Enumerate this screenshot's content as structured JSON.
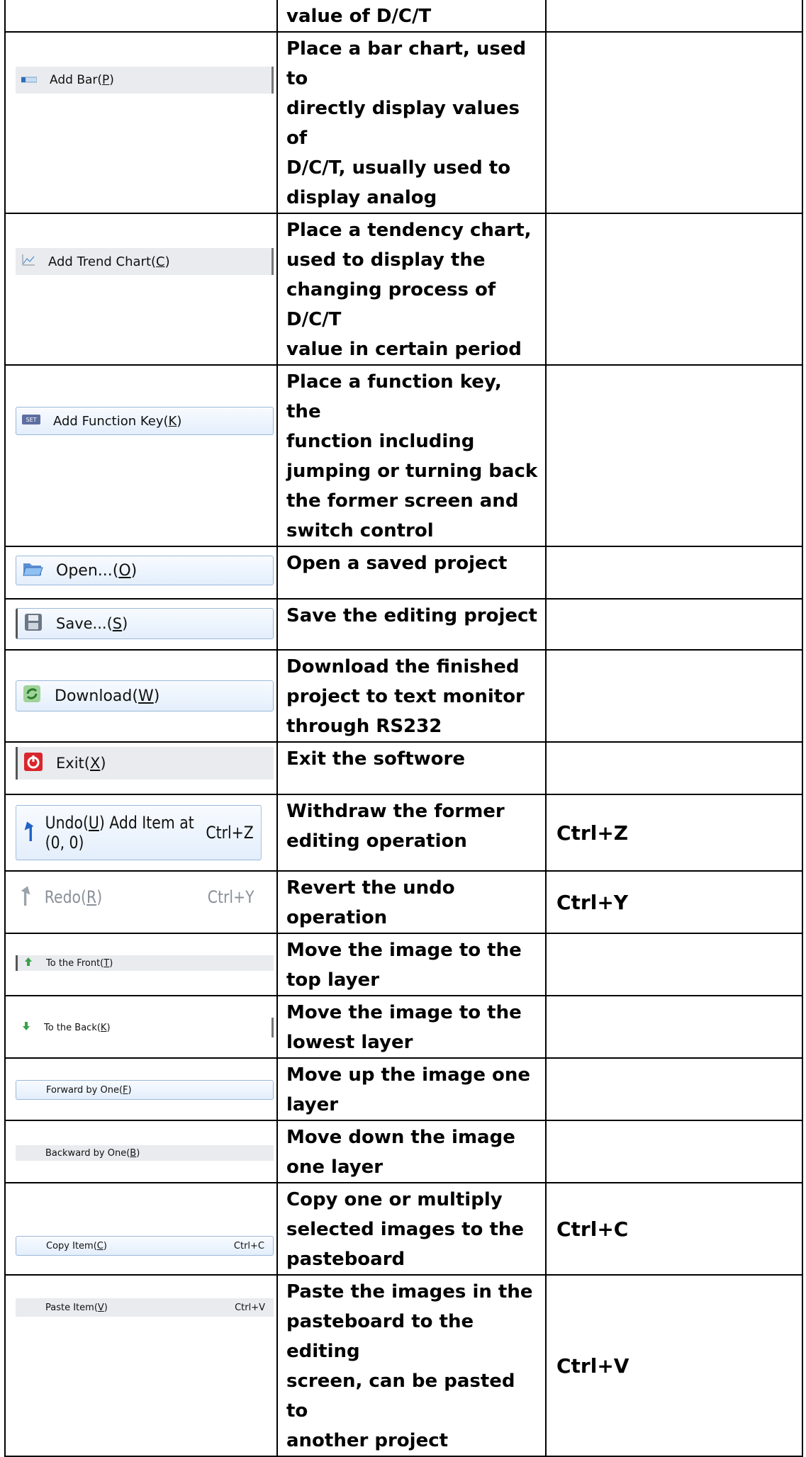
{
  "rows": [
    {
      "tool": {
        "label": "",
        "shortcut": "",
        "icon": ""
      },
      "description": [
        "value of D/C/T"
      ],
      "shortcut": ""
    },
    {
      "tool": {
        "label": "Add Bar(",
        "underline": "P",
        "after": ")",
        "shortcut": "",
        "icon": "bar-icon"
      },
      "description": [
        "Place a bar chart, used to",
        "directly display values of",
        "D/C/T, usually used to",
        "display analog"
      ],
      "shortcut": ""
    },
    {
      "tool": {
        "label": "Add Trend Chart(",
        "underline": "C",
        "after": ")",
        "shortcut": "",
        "icon": "trend-chart-icon"
      },
      "description": [
        "Place a tendency chart,",
        "used to display the",
        "changing process of D/C/T",
        "value in certain period"
      ],
      "shortcut": ""
    },
    {
      "tool": {
        "label": "Add Function Key(",
        "underline": "K",
        "after": ")",
        "shortcut": "",
        "icon": "set-key-icon",
        "icon_text": "SET"
      },
      "description": [
        "Place a function key, the",
        "function including",
        "jumping or turning back",
        "the former screen and",
        "switch control"
      ],
      "shortcut": ""
    },
    {
      "tool": {
        "label": "Open...(",
        "underline": "O",
        "after": ")",
        "shortcut": "",
        "icon": "folder-open-icon"
      },
      "description": [
        "Open a saved project"
      ],
      "shortcut": ""
    },
    {
      "tool": {
        "label": "Save...(",
        "underline": "S",
        "after": ")",
        "shortcut": "",
        "icon": "floppy-disk-icon"
      },
      "description": [
        "Save the editing project"
      ],
      "shortcut": ""
    },
    {
      "tool": {
        "label": "Download(",
        "underline": "W",
        "after": ")",
        "shortcut": "",
        "icon": "download-icon"
      },
      "description": [
        "Download the finished",
        "project to text monitor",
        "through RS232"
      ],
      "shortcut": ""
    },
    {
      "tool": {
        "label": "Exit(",
        "underline": "X",
        "after": ")",
        "shortcut": "",
        "icon": "power-icon"
      },
      "description": [
        "Exit the softwore"
      ],
      "shortcut": ""
    },
    {
      "tool": {
        "label": "Undo(",
        "underline": "U",
        "after": ") Add Item at (0, 0)",
        "shortcut": "Ctrl+Z",
        "icon": "undo-icon"
      },
      "description": [
        "Withdraw the former",
        "editing operation"
      ],
      "shortcut": "Ctrl+Z"
    },
    {
      "tool": {
        "label": "Redo(",
        "underline": "R",
        "after": ")",
        "shortcut": "Ctrl+Y",
        "icon": "redo-icon"
      },
      "description": [
        "Revert the undo",
        "operation"
      ],
      "shortcut": "Ctrl+Y"
    },
    {
      "tool": {
        "label": "To the Front(",
        "underline": "T",
        "after": ")",
        "shortcut": "",
        "icon": "bring-front-icon"
      },
      "description": [
        "Move the image to the",
        "top layer"
      ],
      "shortcut": ""
    },
    {
      "tool": {
        "label": "To the Back(",
        "underline": "K",
        "after": ")",
        "shortcut": "",
        "icon": "send-back-icon"
      },
      "description": [
        "Move the image to the",
        "lowest layer"
      ],
      "shortcut": ""
    },
    {
      "tool": {
        "label": "Forward by One(",
        "underline": "F",
        "after": ")",
        "shortcut": "",
        "icon": ""
      },
      "description": [
        "Move up the image one",
        "layer"
      ],
      "shortcut": ""
    },
    {
      "tool": {
        "label": "Backward by One(",
        "underline": "B",
        "after": ")",
        "shortcut": "",
        "icon": ""
      },
      "description": [
        "Move down the image",
        "one layer"
      ],
      "shortcut": ""
    },
    {
      "tool": {
        "label": "Copy Item(",
        "underline": "C",
        "after": ")",
        "shortcut": "Ctrl+C",
        "icon": ""
      },
      "description": [
        "Copy one or multiply",
        "selected images to the",
        "pasteboard"
      ],
      "shortcut": "Ctrl+C"
    },
    {
      "tool": {
        "label": "Paste Item(",
        "underline": "V",
        "after": ")",
        "shortcut": "Ctrl+V",
        "icon": ""
      },
      "description": [
        "Paste the images in the",
        "pasteboard to the editing",
        "screen, can be pasted to",
        "another project"
      ],
      "shortcut": "Ctrl+V"
    }
  ],
  "colors": {
    "border": "#000000",
    "menu_gray": "#e9ebee",
    "button_blue": "#9bb8d9",
    "exit_red": "#d9262c"
  }
}
